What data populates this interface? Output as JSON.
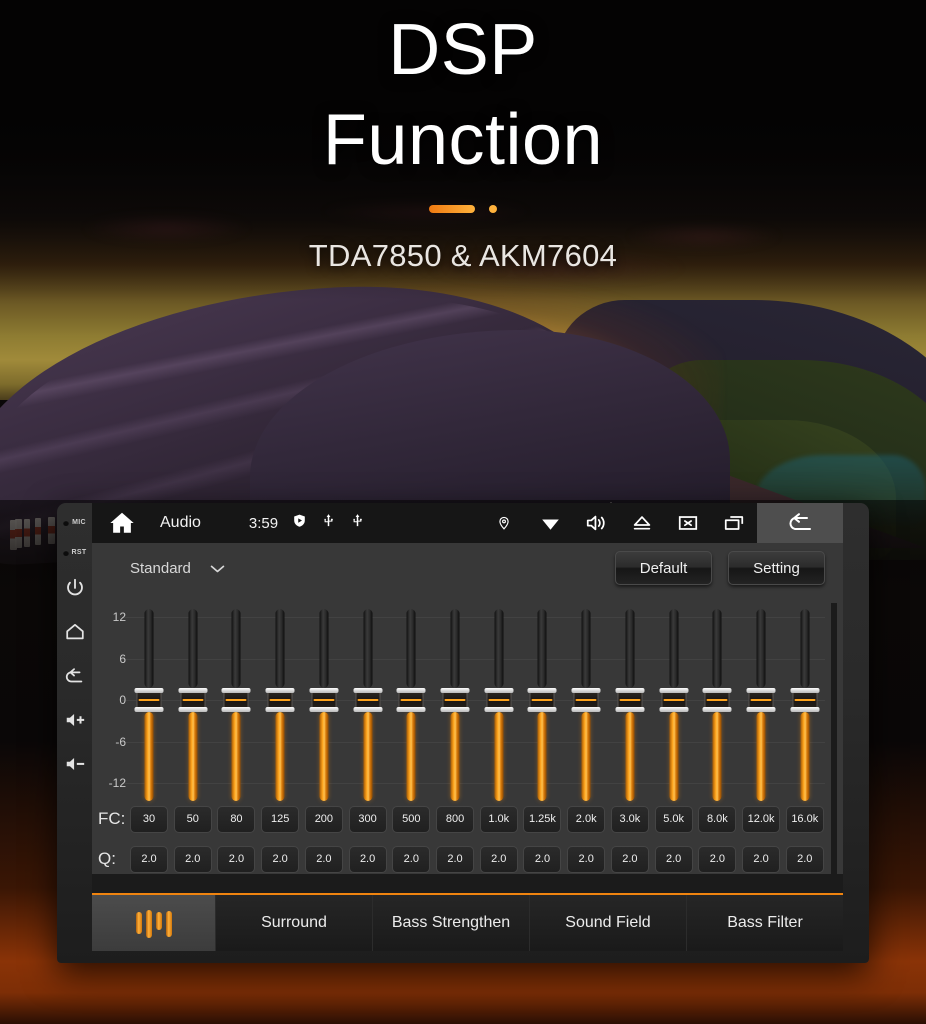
{
  "hero": {
    "title_line1": "DSP",
    "title_line2": "Function",
    "subtitle": "TDA7850 & AKM7604"
  },
  "colors": {
    "accent_orange": "#f0840f",
    "slider_orange": "#ffa41c",
    "screen_bg": "#383838",
    "statusbar_bg": "#161616"
  },
  "device": {
    "bezel": {
      "mic_label": "MIC",
      "rst_label": "RST",
      "buttons": [
        {
          "name": "power",
          "label": "Power"
        },
        {
          "name": "home",
          "label": "Home"
        },
        {
          "name": "back",
          "label": "Back"
        },
        {
          "name": "volume-up",
          "label": "Volume Up"
        },
        {
          "name": "volume-down",
          "label": "Volume Down"
        }
      ]
    },
    "statusbar": {
      "home_icon": "home-icon",
      "title": "Audio",
      "time": "3:59",
      "mid_icons": [
        "shield-play-icon",
        "usb-icon",
        "usb-icon"
      ],
      "right_icons": [
        "location-pin-icon",
        "wifi-icon",
        "volume-icon",
        "eject-icon",
        "close-box-icon",
        "recent-apps-icon"
      ],
      "back_icon": "back-arrow-icon"
    },
    "presetbar": {
      "preset_name": "Standard",
      "dropdown_icon": "chevron-down-icon",
      "default_label": "Default",
      "setting_label": "Setting"
    },
    "equalizer": {
      "fc_label": "FC:",
      "q_label": "Q:",
      "axis_labels": [
        "12",
        "6",
        "0",
        "-6",
        "-12"
      ],
      "bands": [
        {
          "fc": "30",
          "q": "2.0",
          "gain": 0
        },
        {
          "fc": "50",
          "q": "2.0",
          "gain": 0
        },
        {
          "fc": "80",
          "q": "2.0",
          "gain": 0
        },
        {
          "fc": "125",
          "q": "2.0",
          "gain": 0
        },
        {
          "fc": "200",
          "q": "2.0",
          "gain": 0
        },
        {
          "fc": "300",
          "q": "2.0",
          "gain": 0
        },
        {
          "fc": "500",
          "q": "2.0",
          "gain": 0
        },
        {
          "fc": "800",
          "q": "2.0",
          "gain": 0
        },
        {
          "fc": "1.0k",
          "q": "2.0",
          "gain": 0
        },
        {
          "fc": "1.25k",
          "q": "2.0",
          "gain": 0
        },
        {
          "fc": "2.0k",
          "q": "2.0",
          "gain": 0
        },
        {
          "fc": "3.0k",
          "q": "2.0",
          "gain": 0
        },
        {
          "fc": "5.0k",
          "q": "2.0",
          "gain": 0
        },
        {
          "fc": "8.0k",
          "q": "2.0",
          "gain": 0
        },
        {
          "fc": "12.0k",
          "q": "2.0",
          "gain": 0
        },
        {
          "fc": "16.0k",
          "q": "2.0",
          "gain": 0
        }
      ]
    },
    "tabs": [
      {
        "label": "",
        "icon": "equalizer-icon",
        "active": true
      },
      {
        "label": "Surround",
        "active": false
      },
      {
        "label": "Bass Strengthen",
        "active": false
      },
      {
        "label": "Sound Field",
        "active": false
      },
      {
        "label": "Bass Filter",
        "active": false
      }
    ]
  }
}
